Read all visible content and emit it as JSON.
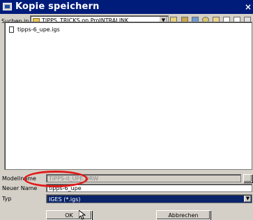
{
  "window": {
    "title": "Kopie speichern",
    "close_glyph": "×"
  },
  "toolbar": {
    "look_in_label": "Suchen in",
    "look_in_value": "TIPPS_TRICKS on ProINTRALINK",
    "dropdown_glyph": "▼",
    "icons": [
      "up-folder-icon",
      "workspace-icon",
      "pdm-icon",
      "web-icon",
      "new-folder-icon",
      "list-view-icon",
      "details-view-icon",
      "view-menu-icon"
    ]
  },
  "files": [
    {
      "name": "tipps-6_upe.igs",
      "icon": "file-icon"
    }
  ],
  "form": {
    "model_name_label": "Modellname",
    "model_name_value": "TIPPS-II_UPE.DRW",
    "new_name_label": "Neuer Name",
    "new_name_value": "tipps-6_upe",
    "type_label": "Typ",
    "type_value": "IGES (*.igs)"
  },
  "buttons": {
    "ok": "OK",
    "cancel": "Abbrechen"
  },
  "annotation": {
    "highlight_color": "#e11a1a"
  }
}
